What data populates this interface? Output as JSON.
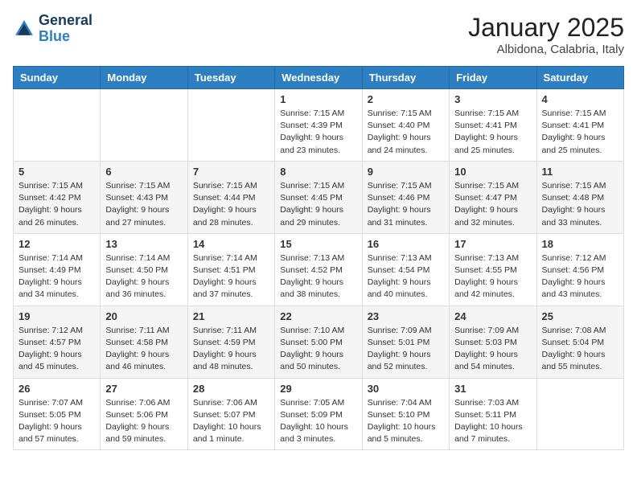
{
  "header": {
    "logo_line1": "General",
    "logo_line2": "Blue",
    "month": "January 2025",
    "location": "Albidona, Calabria, Italy"
  },
  "weekdays": [
    "Sunday",
    "Monday",
    "Tuesday",
    "Wednesday",
    "Thursday",
    "Friday",
    "Saturday"
  ],
  "weeks": [
    [
      {
        "day": "",
        "detail": ""
      },
      {
        "day": "",
        "detail": ""
      },
      {
        "day": "",
        "detail": ""
      },
      {
        "day": "1",
        "detail": "Sunrise: 7:15 AM\nSunset: 4:39 PM\nDaylight: 9 hours and 23 minutes."
      },
      {
        "day": "2",
        "detail": "Sunrise: 7:15 AM\nSunset: 4:40 PM\nDaylight: 9 hours and 24 minutes."
      },
      {
        "day": "3",
        "detail": "Sunrise: 7:15 AM\nSunset: 4:41 PM\nDaylight: 9 hours and 25 minutes."
      },
      {
        "day": "4",
        "detail": "Sunrise: 7:15 AM\nSunset: 4:41 PM\nDaylight: 9 hours and 25 minutes."
      }
    ],
    [
      {
        "day": "5",
        "detail": "Sunrise: 7:15 AM\nSunset: 4:42 PM\nDaylight: 9 hours and 26 minutes."
      },
      {
        "day": "6",
        "detail": "Sunrise: 7:15 AM\nSunset: 4:43 PM\nDaylight: 9 hours and 27 minutes."
      },
      {
        "day": "7",
        "detail": "Sunrise: 7:15 AM\nSunset: 4:44 PM\nDaylight: 9 hours and 28 minutes."
      },
      {
        "day": "8",
        "detail": "Sunrise: 7:15 AM\nSunset: 4:45 PM\nDaylight: 9 hours and 29 minutes."
      },
      {
        "day": "9",
        "detail": "Sunrise: 7:15 AM\nSunset: 4:46 PM\nDaylight: 9 hours and 31 minutes."
      },
      {
        "day": "10",
        "detail": "Sunrise: 7:15 AM\nSunset: 4:47 PM\nDaylight: 9 hours and 32 minutes."
      },
      {
        "day": "11",
        "detail": "Sunrise: 7:15 AM\nSunset: 4:48 PM\nDaylight: 9 hours and 33 minutes."
      }
    ],
    [
      {
        "day": "12",
        "detail": "Sunrise: 7:14 AM\nSunset: 4:49 PM\nDaylight: 9 hours and 34 minutes."
      },
      {
        "day": "13",
        "detail": "Sunrise: 7:14 AM\nSunset: 4:50 PM\nDaylight: 9 hours and 36 minutes."
      },
      {
        "day": "14",
        "detail": "Sunrise: 7:14 AM\nSunset: 4:51 PM\nDaylight: 9 hours and 37 minutes."
      },
      {
        "day": "15",
        "detail": "Sunrise: 7:13 AM\nSunset: 4:52 PM\nDaylight: 9 hours and 38 minutes."
      },
      {
        "day": "16",
        "detail": "Sunrise: 7:13 AM\nSunset: 4:54 PM\nDaylight: 9 hours and 40 minutes."
      },
      {
        "day": "17",
        "detail": "Sunrise: 7:13 AM\nSunset: 4:55 PM\nDaylight: 9 hours and 42 minutes."
      },
      {
        "day": "18",
        "detail": "Sunrise: 7:12 AM\nSunset: 4:56 PM\nDaylight: 9 hours and 43 minutes."
      }
    ],
    [
      {
        "day": "19",
        "detail": "Sunrise: 7:12 AM\nSunset: 4:57 PM\nDaylight: 9 hours and 45 minutes."
      },
      {
        "day": "20",
        "detail": "Sunrise: 7:11 AM\nSunset: 4:58 PM\nDaylight: 9 hours and 46 minutes."
      },
      {
        "day": "21",
        "detail": "Sunrise: 7:11 AM\nSunset: 4:59 PM\nDaylight: 9 hours and 48 minutes."
      },
      {
        "day": "22",
        "detail": "Sunrise: 7:10 AM\nSunset: 5:00 PM\nDaylight: 9 hours and 50 minutes."
      },
      {
        "day": "23",
        "detail": "Sunrise: 7:09 AM\nSunset: 5:01 PM\nDaylight: 9 hours and 52 minutes."
      },
      {
        "day": "24",
        "detail": "Sunrise: 7:09 AM\nSunset: 5:03 PM\nDaylight: 9 hours and 54 minutes."
      },
      {
        "day": "25",
        "detail": "Sunrise: 7:08 AM\nSunset: 5:04 PM\nDaylight: 9 hours and 55 minutes."
      }
    ],
    [
      {
        "day": "26",
        "detail": "Sunrise: 7:07 AM\nSunset: 5:05 PM\nDaylight: 9 hours and 57 minutes."
      },
      {
        "day": "27",
        "detail": "Sunrise: 7:06 AM\nSunset: 5:06 PM\nDaylight: 9 hours and 59 minutes."
      },
      {
        "day": "28",
        "detail": "Sunrise: 7:06 AM\nSunset: 5:07 PM\nDaylight: 10 hours and 1 minute."
      },
      {
        "day": "29",
        "detail": "Sunrise: 7:05 AM\nSunset: 5:09 PM\nDaylight: 10 hours and 3 minutes."
      },
      {
        "day": "30",
        "detail": "Sunrise: 7:04 AM\nSunset: 5:10 PM\nDaylight: 10 hours and 5 minutes."
      },
      {
        "day": "31",
        "detail": "Sunrise: 7:03 AM\nSunset: 5:11 PM\nDaylight: 10 hours and 7 minutes."
      },
      {
        "day": "",
        "detail": ""
      }
    ]
  ]
}
